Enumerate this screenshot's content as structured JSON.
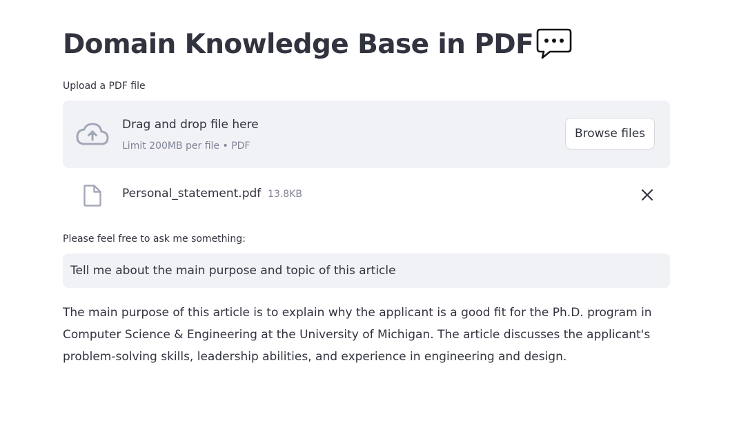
{
  "header": {
    "title": "Domain Knowledge Base in PDF",
    "title_emoji": "speech-balloon-icon"
  },
  "uploader": {
    "label": "Upload a PDF file",
    "drop_text": "Drag and drop file here",
    "limit_text": "Limit 200MB per file • PDF",
    "browse_label": "Browse files",
    "icon": "cloud-upload-icon"
  },
  "uploaded_file": {
    "name": "Personal_statement.pdf",
    "size": "13.8KB",
    "icon": "file-icon",
    "remove_icon": "close-icon"
  },
  "question": {
    "label": "Please feel free to ask me something:",
    "value": "Tell me about the main purpose and topic of this article"
  },
  "answer": {
    "text": "The main purpose of this article is to explain why the applicant is a good fit for the Ph.D. program in Computer Science & Engineering at the University of Michigan. The article discusses the applicant's problem-solving skills, leadership abilities, and experience in engineering and design."
  },
  "colors": {
    "text": "#31333f",
    "muted": "#808495",
    "widget_bg": "#f0f2f6",
    "icon": "#a3a8b8",
    "page_bg": "#ffffff"
  }
}
